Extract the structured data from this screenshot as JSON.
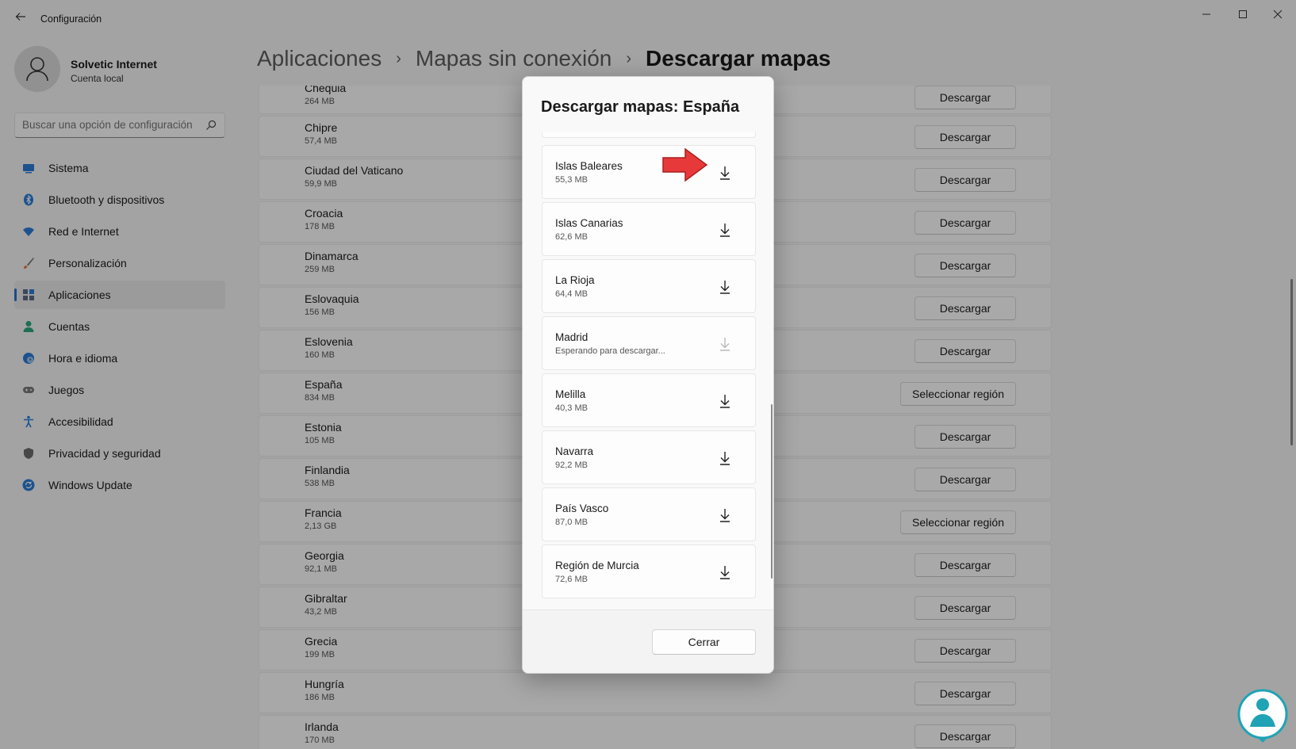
{
  "window": {
    "title": "Configuración",
    "controls": {
      "minimize": "—",
      "maximize": "☐",
      "close": "✕"
    }
  },
  "profile": {
    "name": "Solvetic Internet",
    "account": "Cuenta local"
  },
  "search": {
    "placeholder": "Buscar una opción de configuración"
  },
  "nav": {
    "items": [
      {
        "label": "Sistema",
        "icon": "system-icon"
      },
      {
        "label": "Bluetooth y dispositivos",
        "icon": "bluetooth-icon"
      },
      {
        "label": "Red e Internet",
        "icon": "wifi-icon"
      },
      {
        "label": "Personalización",
        "icon": "brush-icon"
      },
      {
        "label": "Aplicaciones",
        "icon": "apps-icon",
        "active": true
      },
      {
        "label": "Cuentas",
        "icon": "person-icon"
      },
      {
        "label": "Hora e idioma",
        "icon": "clock-globe-icon"
      },
      {
        "label": "Juegos",
        "icon": "gamepad-icon"
      },
      {
        "label": "Accesibilidad",
        "icon": "accessibility-icon"
      },
      {
        "label": "Privacidad y seguridad",
        "icon": "shield-icon"
      },
      {
        "label": "Windows Update",
        "icon": "update-icon"
      }
    ]
  },
  "breadcrumb": {
    "first": "Aplicaciones",
    "second": "Mapas sin conexión",
    "current": "Descargar mapas",
    "separator": "›"
  },
  "countries": [
    {
      "name": "Chequia",
      "size": "264 MB",
      "action": "Descargar"
    },
    {
      "name": "Chipre",
      "size": "57,4 MB",
      "action": "Descargar"
    },
    {
      "name": "Ciudad del Vaticano",
      "size": "59,9 MB",
      "action": "Descargar"
    },
    {
      "name": "Croacia",
      "size": "178 MB",
      "action": "Descargar"
    },
    {
      "name": "Dinamarca",
      "size": "259 MB",
      "action": "Descargar"
    },
    {
      "name": "Eslovaquia",
      "size": "156 MB",
      "action": "Descargar"
    },
    {
      "name": "Eslovenia",
      "size": "160 MB",
      "action": "Descargar"
    },
    {
      "name": "España",
      "size": "834 MB",
      "action": "Seleccionar región"
    },
    {
      "name": "Estonia",
      "size": "105 MB",
      "action": "Descargar"
    },
    {
      "name": "Finlandia",
      "size": "538 MB",
      "action": "Descargar"
    },
    {
      "name": "Francia",
      "size": "2,13 GB",
      "action": "Seleccionar región"
    },
    {
      "name": "Georgia",
      "size": "92,1 MB",
      "action": "Descargar"
    },
    {
      "name": "Gibraltar",
      "size": "43,2 MB",
      "action": "Descargar"
    },
    {
      "name": "Grecia",
      "size": "199 MB",
      "action": "Descargar"
    },
    {
      "name": "Hungría",
      "size": "186 MB",
      "action": "Descargar"
    },
    {
      "name": "Irlanda",
      "size": "170 MB",
      "action": "Descargar"
    }
  ],
  "dialog": {
    "title": "Descargar mapas: España",
    "regions": [
      {
        "name": "Islas Baleares",
        "status": "55,3 MB",
        "disabled": false
      },
      {
        "name": "Islas Canarias",
        "status": "62,6 MB",
        "disabled": false
      },
      {
        "name": "La Rioja",
        "status": "64,4 MB",
        "disabled": false
      },
      {
        "name": "Madrid",
        "status": "Esperando para descargar...",
        "disabled": true
      },
      {
        "name": "Melilla",
        "status": "40,3 MB",
        "disabled": false
      },
      {
        "name": "Navarra",
        "status": "92,2 MB",
        "disabled": false
      },
      {
        "name": "País Vasco",
        "status": "87,0 MB",
        "disabled": false
      },
      {
        "name": "Región de Murcia",
        "status": "72,6 MB",
        "disabled": false
      }
    ],
    "close_label": "Cerrar"
  },
  "colors": {
    "accent": "#2a6fc9",
    "arrow": "#e8393a",
    "logo": "#1fa3b5"
  }
}
